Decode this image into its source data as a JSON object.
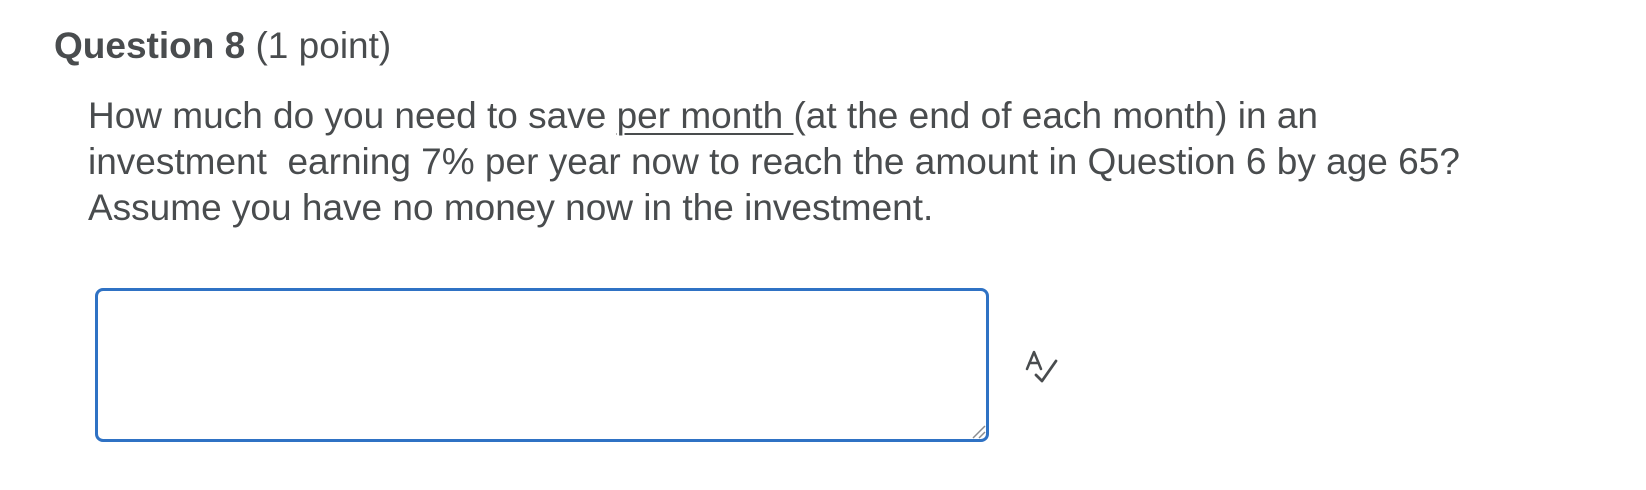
{
  "question": {
    "title": "Question 8",
    "points": "(1 point)",
    "body": {
      "line1_before": "How much do you need to save ",
      "line1_underlined": "per month ",
      "line1_after": "(at the end of each month) in an",
      "line2": "investment  earning 7% per year now to reach the amount in Question 6 by age 65?",
      "line3": "Assume you have no money now in the investment."
    }
  },
  "answer": {
    "value": "",
    "placeholder": ""
  },
  "icons": {
    "spellcheck": "spellcheck-icon",
    "resize": "resize-handle-icon"
  },
  "colors": {
    "text": "#494c4e",
    "focus_border": "#2f72c4"
  }
}
